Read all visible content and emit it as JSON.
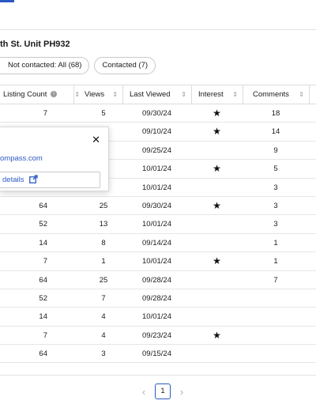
{
  "property": {
    "address_fragment": "th St. Unit PH932"
  },
  "filters": [
    {
      "label": "Not contacted: All (68)"
    },
    {
      "label": "Contacted (7)"
    }
  ],
  "table": {
    "headers": {
      "listing_count": "Listing Count",
      "views": "Views",
      "last_viewed": "Last Viewed",
      "interest": "Interest",
      "comments": "Comments"
    },
    "rows": [
      {
        "listing_count": "7",
        "views": "5",
        "last_viewed": "09/30/24",
        "interest": true,
        "comments": "18"
      },
      {
        "listing_count": "",
        "views": "",
        "last_viewed": "09/10/24",
        "interest": true,
        "comments": "14"
      },
      {
        "listing_count": "",
        "views": "",
        "last_viewed": "09/25/24",
        "interest": false,
        "comments": "9"
      },
      {
        "listing_count": "",
        "views": "",
        "last_viewed": "10/01/24",
        "interest": true,
        "comments": "5"
      },
      {
        "listing_count": "",
        "views": "",
        "last_viewed": "10/01/24",
        "interest": false,
        "comments": "3"
      },
      {
        "listing_count": "64",
        "views": "25",
        "last_viewed": "09/30/24",
        "interest": true,
        "comments": "3"
      },
      {
        "listing_count": "52",
        "views": "13",
        "last_viewed": "10/01/24",
        "interest": false,
        "comments": "3"
      },
      {
        "listing_count": "14",
        "views": "8",
        "last_viewed": "09/14/24",
        "interest": false,
        "comments": "1"
      },
      {
        "listing_count": "7",
        "views": "1",
        "last_viewed": "10/01/24",
        "interest": true,
        "comments": "1"
      },
      {
        "listing_count": "64",
        "views": "25",
        "last_viewed": "09/28/24",
        "interest": false,
        "comments": "7"
      },
      {
        "listing_count": "52",
        "views": "7",
        "last_viewed": "09/28/24",
        "interest": false,
        "comments": ""
      },
      {
        "listing_count": "14",
        "views": "4",
        "last_viewed": "10/01/24",
        "interest": false,
        "comments": ""
      },
      {
        "listing_count": "7",
        "views": "4",
        "last_viewed": "09/23/24",
        "interest": true,
        "comments": ""
      },
      {
        "listing_count": "64",
        "views": "3",
        "last_viewed": "09/15/24",
        "interest": false,
        "comments": ""
      }
    ]
  },
  "popover": {
    "close_label": "✕",
    "email_fragment": "ompass.com",
    "details_label": "details"
  },
  "pagination": {
    "prev": "‹",
    "current_page": "1",
    "next": "›"
  },
  "icons": {
    "sort": "sort-icon",
    "info": "info-icon",
    "star": "star-icon",
    "close": "close-icon",
    "external_link": "external-link-icon"
  },
  "colors": {
    "accent": "#2b59c3",
    "border": "#dcdcdc",
    "text": "#1a1a1a"
  }
}
